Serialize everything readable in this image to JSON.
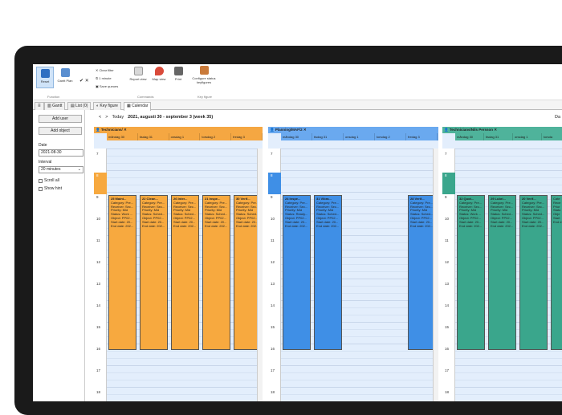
{
  "ribbon": {
    "reset": "Reset",
    "gantt_plan": "Gantt Plan",
    "function_caption": "Function",
    "clear_filter": "Clear filter",
    "one_minute": "1 minute",
    "save_queues": "Save queues",
    "report_view": "Report view",
    "map_view": "Map view",
    "print": "Print",
    "commands_caption": "Commands",
    "configure": "Configure status keyfigures",
    "keyfigure_caption": "Key figure"
  },
  "tabs": [
    {
      "label": "Gantt"
    },
    {
      "label": "List (0)"
    },
    {
      "label": "Key figure"
    },
    {
      "label": "Calendar"
    }
  ],
  "left": {
    "add_user": "Add user",
    "add_object": "Add object",
    "date_label": "Date",
    "date_value": "2021-08-30",
    "interval_label": "Interval",
    "interval_value": "20 minutes",
    "scroll_all": "Scroll all",
    "show_hint": "Show hint"
  },
  "nav": {
    "prev": "<",
    "next": ">",
    "today": "Today",
    "range": "2021, augusti 30 - september 3 (week 35)",
    "right": "Da"
  },
  "resources": [
    {
      "name": "Technicians/",
      "color": "#f5a742",
      "cardColor": "#f7a93f",
      "days": [
        "måndag 30",
        "tisdag 31",
        "onsdag 1",
        "torsdag 2",
        "fredag 3"
      ],
      "cards": [
        {
          "title": "25 Maint...",
          "category": "Category: Pre...",
          "receiver": "Receiver: Sec...",
          "priority": "Priority: Mid",
          "status": "Status: Work ...",
          "object": "Object: PP02...",
          "start": "Start date: 20...",
          "end": "End date: 202..."
        },
        {
          "title": "22 Clean...",
          "category": "Category: Pre...",
          "receiver": "Receiver: Sec...",
          "priority": "Priority: Mid",
          "status": "Status: Sched...",
          "object": "Object: PP02...",
          "start": "Start date: 20...",
          "end": "End date: 202..."
        },
        {
          "title": "26 Inter...",
          "category": "Category: Pre...",
          "receiver": "Receiver: Sec...",
          "priority": "Priority: Mid",
          "status": "Status: Sched...",
          "object": "Object: PP02...",
          "start": "Start date: 20...",
          "end": "End date: 202..."
        },
        {
          "title": "21 Inspe...",
          "category": "Category: Pre...",
          "receiver": "Receiver: Sec...",
          "priority": "Priority: Mid",
          "status": "Status: Sched...",
          "object": "Object: PP02...",
          "start": "Start date: 20...",
          "end": "End date: 202..."
        },
        {
          "title": "30 Verif...",
          "category": "Category: Pre...",
          "receiver": "Receiver: Sec...",
          "priority": "Priority: Mid",
          "status": "Status: Sched...",
          "object": "Object: PP02...",
          "start": "Start date: 20...",
          "end": "End date: 202..."
        }
      ]
    },
    {
      "name": "Planning/MAF/2",
      "color": "#6aa9ef",
      "cardColor": "#3f8fe6",
      "days": [
        "måndag 30",
        "tisdag 31",
        "onsdag 1",
        "torsdag 2",
        "fredag 3"
      ],
      "cards": [
        {
          "title": "24 Inspe...",
          "category": "Category: Pre...",
          "receiver": "Receiver: Sec...",
          "priority": "Priority: Mid",
          "status": "Status: Ready...",
          "object": "Object: PP02...",
          "start": "Start date: 20...",
          "end": "End date: 202..."
        },
        {
          "title": "31 Vibra...",
          "category": "Category: Pre...",
          "receiver": "Receiver: Sec...",
          "priority": "Priority: Mid",
          "status": "Status: Sched...",
          "object": "Object: PP02...",
          "start": "Start date: 20...",
          "end": "End date: 202..."
        },
        {
          "title": "28 Verif...",
          "category": "Category: Pre...",
          "receiver": "Receiver: Sec...",
          "priority": "Priority: Mid",
          "status": "Status: Sched...",
          "object": "Object: PP02...",
          "start": "Start date: 20...",
          "end": "End date: 202..."
        }
      ]
    },
    {
      "name": "Technicians/Nils Persson",
      "color": "#4fb39b",
      "cardColor": "#3aa68c",
      "days": [
        "måndag 30",
        "tisdag 31",
        "onsdag 1",
        "torsda"
      ],
      "cards": [
        {
          "title": "32 Quot...",
          "category": "Category: Pre...",
          "receiver": "Receiver: Sec...",
          "priority": "Priority: Mid",
          "status": "Status: Work ...",
          "object": "Object: PP02...",
          "start": "Start date: 20...",
          "end": "End date: 202..."
        },
        {
          "title": "29 Lubri...",
          "category": "Category: Pre...",
          "receiver": "Receiver: Sec...",
          "priority": "Priority: Mid",
          "status": "Status: Sched...",
          "object": "Object: PP02...",
          "start": "Start date: 20...",
          "end": "End date: 202..."
        },
        {
          "title": "20 Verif...",
          "category": "Category: Pre...",
          "receiver": "Receiver: Sec...",
          "priority": "Priority: Mid",
          "status": "Status: Sched...",
          "object": "Object: PP02...",
          "start": "Start date: 20...",
          "end": "End date: 202..."
        },
        {
          "title": "",
          "category": "Cate",
          "receiver": "Rece",
          "priority": "Prior",
          "status": "Statu",
          "object": "Obje",
          "start": "Start",
          "end": "End d"
        }
      ]
    }
  ],
  "hours": [
    "7",
    "8",
    "9",
    "10",
    "11",
    "12",
    "13",
    "14",
    "15",
    "16",
    "17",
    "18"
  ]
}
